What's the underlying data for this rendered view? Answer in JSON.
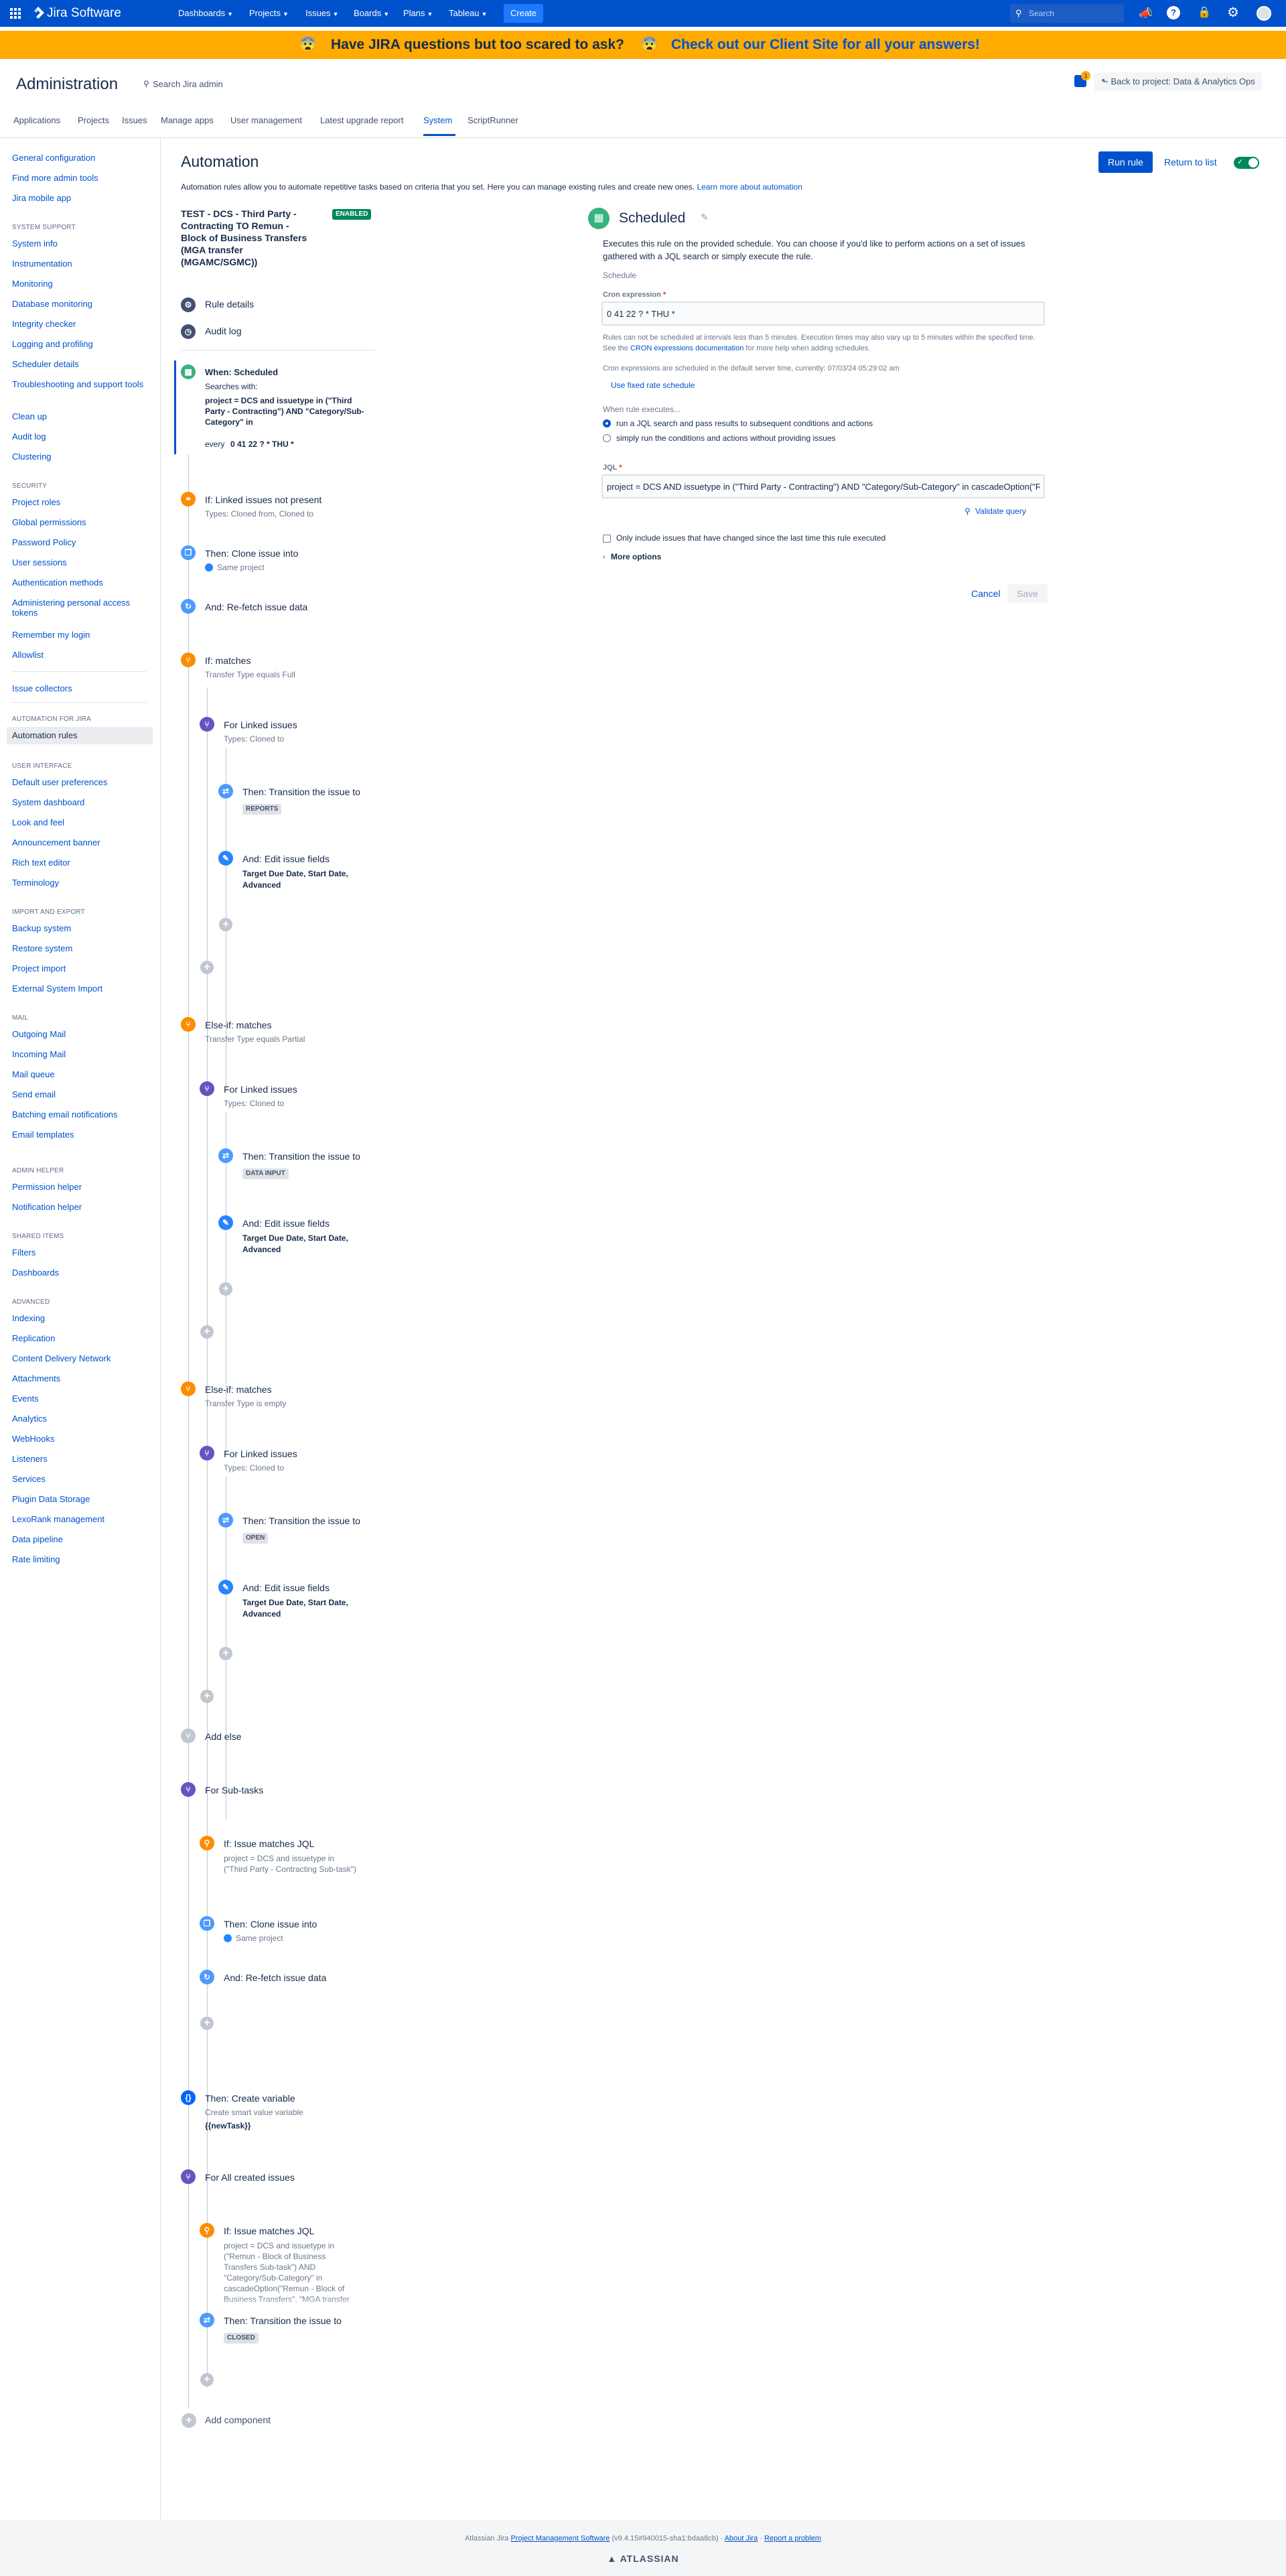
{
  "topnav": {
    "logo": "Jira Software",
    "items": [
      "Dashboards",
      "Projects",
      "Issues",
      "Boards",
      "Plans",
      "Tableau"
    ],
    "create": "Create",
    "search_placeholder": "Search"
  },
  "banner": {
    "question": "Have JIRA questions but too scared to ask?",
    "link": "Check out our Client Site for all your answers!",
    "icon": "scared-face-emoji"
  },
  "admin": {
    "title": "Administration",
    "search_placeholder": "Search Jira admin",
    "notif_count": "1",
    "back_button": "Back to project: Data & Analytics Ops",
    "tabs": [
      "Applications",
      "Projects",
      "Issues",
      "Manage apps",
      "User management",
      "Latest upgrade report",
      "System",
      "ScriptRunner"
    ],
    "selected_tab": "System"
  },
  "sidebar": {
    "top": [
      "General configuration",
      "Find more admin tools",
      "Jira mobile app"
    ],
    "groups": [
      {
        "title": "System support",
        "items": [
          "System info",
          "Instrumentation",
          "Monitoring",
          "Database monitoring",
          "Integrity checker",
          "Logging and profiling",
          "Scheduler details",
          "Troubleshooting and support tools",
          "Clean up",
          "Audit log",
          "Clustering"
        ]
      },
      {
        "title": "Security",
        "items": [
          "Project roles",
          "Global permissions",
          "Password Policy",
          "User sessions",
          "Authentication methods",
          "Administering personal access tokens",
          "Remember my login",
          "Allowlist"
        ]
      },
      {
        "title": "",
        "items": [
          "Issue collectors"
        ]
      },
      {
        "title": "Automation for Jira",
        "items": [
          "Automation rules"
        ]
      },
      {
        "title": "User interface",
        "items": [
          "Default user preferences",
          "System dashboard",
          "Look and feel",
          "Announcement banner",
          "Rich text editor",
          "Terminology"
        ]
      },
      {
        "title": "Import and export",
        "items": [
          "Backup system",
          "Restore system",
          "Project import",
          "External System Import"
        ]
      },
      {
        "title": "Mail",
        "items": [
          "Outgoing Mail",
          "Incoming Mail",
          "Mail queue",
          "Send email",
          "Batching email notifications",
          "Email templates"
        ]
      },
      {
        "title": "Admin Helper",
        "items": [
          "Permission helper",
          "Notification helper"
        ]
      },
      {
        "title": "Shared items",
        "items": [
          "Filters",
          "Dashboards"
        ]
      },
      {
        "title": "Advanced",
        "items": [
          "Indexing",
          "Replication",
          "Content Delivery Network",
          "Attachments",
          "Events",
          "Analytics",
          "WebHooks",
          "Listeners",
          "Services",
          "Plugin Data Storage",
          "LexoRank management",
          "Data pipeline",
          "Rate limiting"
        ]
      }
    ],
    "selected": "Automation rules"
  },
  "automation": {
    "title": "Automation",
    "description": "Automation rules allow you to automate repetitive tasks based on criteria that you set. Here you can manage existing rules and create new ones.",
    "learn_more": "Learn more about automation",
    "run_rule": "Run rule",
    "return_to_list": "Return to list"
  },
  "rule": {
    "name": "TEST - DCS - Third Party - Contracting TO Remun - Block of Business Transfers (MGA transfer (MGAMC/SGMC))",
    "status": "ENABLED",
    "details": "Rule details",
    "audit": "Audit log",
    "trigger": {
      "title": "When: Scheduled",
      "searches": "Searches with:",
      "jql": "project = DCS and issuetype in (\"Third Party - Contracting\") AND \"Category/Sub-Category\" in",
      "every": "every",
      "cron": "0 41 22 ? * THU *"
    },
    "c1": {
      "title": "If: Linked issues not present",
      "sub": "Types: Cloned from, Cloned to"
    },
    "c2": {
      "title": "Then: Clone issue into",
      "sub": "Same project"
    },
    "c3": {
      "title": "And: Re-fetch issue data"
    },
    "branches": [
      {
        "title": "If: matches",
        "sub": "Transfer Type equals Full",
        "for": "For Linked issues",
        "for_sub": "Types: Cloned to",
        "t": "Then: Transition the issue to",
        "status": "REPORTS",
        "e": "And: Edit issue fields",
        "fields": "Target Due Date, Start Date, Advanced"
      },
      {
        "title": "Else-if: matches",
        "sub": "Transfer Type equals Partial",
        "for": "For Linked issues",
        "for_sub": "Types: Cloned to",
        "t": "Then: Transition the issue to",
        "status": "DATA INPUT",
        "e": "And: Edit issue fields",
        "fields": "Target Due Date, Start Date, Advanced"
      },
      {
        "title": "Else-if: matches",
        "sub": "Transfer Type is empty",
        "for": "For Linked issues",
        "for_sub": "Types: Cloned to",
        "t": "Then: Transition the issue to",
        "status": "OPEN",
        "e": "And: Edit issue fields",
        "fields": "Target Due Date, Start Date, Advanced"
      }
    ],
    "add_else": "Add else",
    "subtasks": {
      "title": "For Sub-tasks",
      "jql_title": "If: Issue matches JQL",
      "jql": "project = DCS and issuetype in (\"Third Party - Contracting Sub-task\")",
      "clone": "Then: Clone issue into",
      "clone_sub": "Same project",
      "refetch": "And: Re-fetch issue data"
    },
    "variable": {
      "title": "Then: Create variable",
      "sub": "Create smart value variable",
      "name": "{{newTask}}"
    },
    "created": {
      "title": "For All created issues",
      "jql_title": "If: Issue matches JQL",
      "jql": "project = DCS and issuetype in (\"Remun - Block of Business Transfers Sub-task\") AND \"Category/Sub-Category\" in cascadeOption(\"Remun - Block of Business Transfers\", \"MGA transfer",
      "t": "Then: Transition the issue to",
      "status": "CLOSED"
    },
    "add_component": "Add component"
  },
  "panel": {
    "title": "Scheduled",
    "description": "Executes this rule on the provided schedule. You can choose if you'd like to perform actions on a set of issues gathered with a JQL search or simply execute the rule.",
    "schedule_label": "Schedule",
    "cron_label": "Cron expression",
    "cron_value": "0 41 22 ? * THU *",
    "help1": "Rules can not be scheduled at intervals less than 5 minutes. Execution times may also vary up to 5 minutes within the specified time. See the",
    "help1_link": "CRON expressions documentation",
    "help1_end": "for more help when adding schedules.",
    "help2": "Cron expressions are scheduled in the default server time, currently: 07/03/24 05:29:02 am",
    "fixed_rate": "Use fixed rate schedule",
    "when_label": "When rule executes...",
    "opt1": "run a JQL search and pass results to subsequent conditions and actions",
    "opt2": "simply run the conditions and actions without providing issues",
    "jql_label": "JQL",
    "jql_value": "project = DCS AND issuetype in (\"Third Party - Contracting\") AND \"Category/Sub-Category\" in cascadeOption(\"Remun - Block of Business Transfers\", \"MGA transfer (MGAMC/SGMC)\")",
    "validate": "Validate query",
    "only_changed": "Only include issues that have changed since the last time this rule executed",
    "more": "More options",
    "cancel": "Cancel",
    "save": "Save"
  },
  "footer": {
    "prefix": "Atlassian Jira",
    "pm": "Project Management Software",
    "version": "(v9.4.15#940015-sha1:bdaa8cb)",
    "about": "About Jira",
    "report": "Report a problem",
    "brand": "ATLASSIAN"
  },
  "colors": {
    "brand": "#0052cc",
    "banner": "#ffab00",
    "enabled": "#00875a"
  }
}
